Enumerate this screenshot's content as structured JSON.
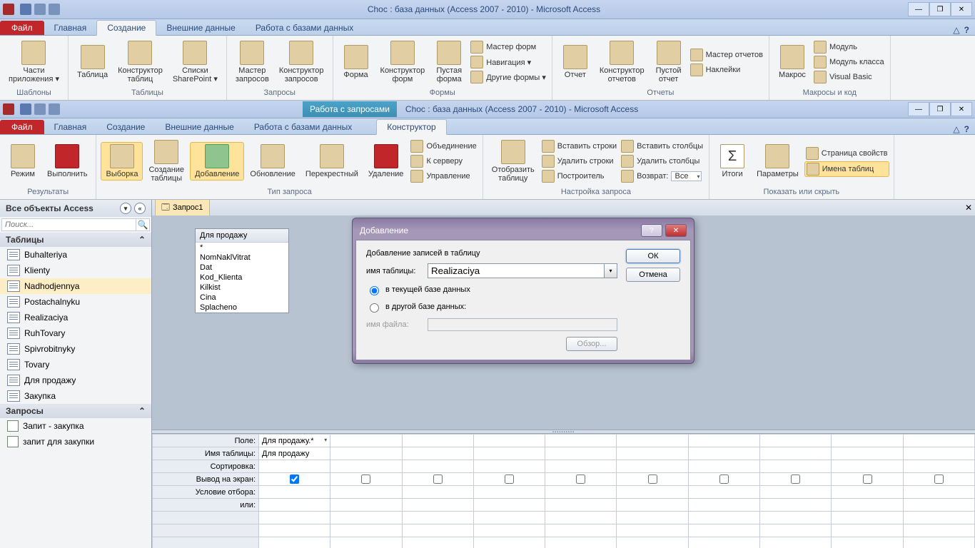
{
  "win1": {
    "title": "Choc : база данных (Access 2007 - 2010)  -  Microsoft Access",
    "tabs": {
      "file": "Файл",
      "home": "Главная",
      "create": "Создание",
      "ext": "Внешние данные",
      "db": "Работа с базами данных"
    }
  },
  "ribbon1": {
    "g1": {
      "parts": "Части\nприложения ▾",
      "label": "Шаблоны"
    },
    "g2": {
      "table": "Таблица",
      "design": "Конструктор\nтаблиц",
      "sp": "Списки\nSharePoint ▾",
      "label": "Таблицы"
    },
    "g3": {
      "qw": "Мастер\nзапросов",
      "qd": "Конструктор\nзапросов",
      "label": "Запросы"
    },
    "g4": {
      "form": "Форма",
      "fd": "Конструктор\nформ",
      "blank": "Пустая\nформа",
      "fw": "Мастер форм",
      "nav": "Навигация ▾",
      "other": "Другие формы ▾",
      "label": "Формы"
    },
    "g5": {
      "rpt": "Отчет",
      "rd": "Конструктор\nотчетов",
      "blank": "Пустой\nотчет",
      "rw": "Мастер отчетов",
      "lbl": "Наклейки",
      "label": "Отчеты"
    },
    "g6": {
      "macro": "Макрос",
      "mod": "Модуль",
      "cls": "Модуль класса",
      "vb": "Visual Basic",
      "label": "Макросы и код"
    }
  },
  "win2": {
    "title": "Choc : база данных (Access 2007 - 2010)  -  Microsoft Access",
    "ctx": "Работа с запросами",
    "tabs": {
      "file": "Файл",
      "home": "Главная",
      "create": "Создание",
      "ext": "Внешние данные",
      "db": "Работа с базами данных",
      "des": "Конструктор"
    }
  },
  "ribbon2": {
    "g1": {
      "mode": "Режим",
      "run": "Выполнить",
      "label": "Результаты"
    },
    "g2": {
      "sel": "Выборка",
      "mk": "Создание\nтаблицы",
      "app": "Добавление",
      "upd": "Обновление",
      "cross": "Перекрестный",
      "del": "Удаление",
      "union": "Объединение",
      "srv": "К серверу",
      "mgr": "Управление",
      "label": "Тип запроса"
    },
    "g3": {
      "show": "Отобразить\nтаблицу",
      "ir": "Вставить строки",
      "dr": "Удалить строки",
      "bld": "Построитель",
      "ic": "Вставить столбцы",
      "dc": "Удалить столбцы",
      "ret": "Возврат:",
      "retval": "Все",
      "label": "Настройка запроса"
    },
    "g4": {
      "tot": "Итоги",
      "par": "Параметры",
      "ps": "Страница свойств",
      "tn": "Имена таблиц",
      "label": "Показать или скрыть"
    }
  },
  "nav": {
    "head": "Все объекты Access",
    "search": "Поиск...",
    "tables_head": "Таблицы",
    "tables": [
      "Buhalteriya",
      "Klienty",
      "Nadhodjennya",
      "Postachalnyku",
      "Realizaciya",
      "RuhTovary",
      "Spivrobitnyky",
      "Tovary",
      "Для продажу",
      "Закупка"
    ],
    "queries_head": "Запросы",
    "queries": [
      "Запит - закупка",
      "запит для закупки"
    ]
  },
  "doc": {
    "tab": "Запрос1"
  },
  "tablebox": {
    "title": "Для продажу",
    "fields": [
      "*",
      "NomNaklVitrat",
      "Dat",
      "Kod_Klienta",
      "Kilkist",
      "Cina",
      "Splacheno"
    ]
  },
  "dialog": {
    "title": "Добавление",
    "header": "Добавление записей в таблицу",
    "tbl_label": "имя таблицы:",
    "tbl_value": "Realizaciya",
    "opt1": "в текущей базе данных",
    "opt2": "в другой базе данных:",
    "file_label": "имя файла:",
    "browse": "Обзор...",
    "ok": "ОК",
    "cancel": "Отмена"
  },
  "grid": {
    "rows": [
      "Поле:",
      "Имя таблицы:",
      "Сортировка:",
      "Вывод на экран:",
      "Условие отбора:",
      "или:"
    ],
    "c1_field": "Для продажу.*",
    "c1_table": "Для продажу"
  }
}
